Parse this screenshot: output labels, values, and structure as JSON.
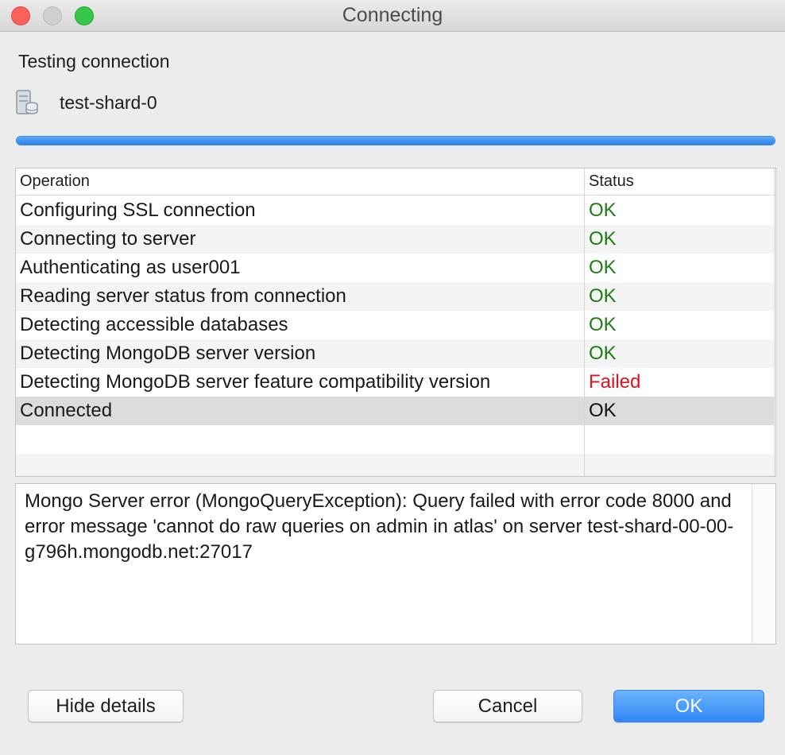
{
  "window": {
    "title": "Connecting"
  },
  "header": {
    "status_text": "Testing connection",
    "server_name": "test-shard-0"
  },
  "progress": {
    "value": 100
  },
  "table": {
    "columns": {
      "operation": "Operation",
      "status": "Status"
    },
    "rows": [
      {
        "operation": "Configuring SSL connection",
        "status": "OK"
      },
      {
        "operation": "Connecting to server",
        "status": "OK"
      },
      {
        "operation": "Authenticating as user001",
        "status": "OK"
      },
      {
        "operation": "Reading server status from connection",
        "status": "OK"
      },
      {
        "operation": "Detecting accessible databases",
        "status": "OK"
      },
      {
        "operation": "Detecting MongoDB server version",
        "status": "OK"
      },
      {
        "operation": "Detecting MongoDB server feature compatibility version",
        "status": "Failed"
      },
      {
        "operation": "Connected",
        "status": "OK"
      }
    ]
  },
  "details": {
    "message": "Mongo Server error (MongoQueryException): Query failed with error code 8000 and error message 'cannot do raw queries on admin in atlas' on server test-shard-00-00-g796h.mongodb.net:27017"
  },
  "buttons": {
    "hide_details": "Hide details",
    "cancel": "Cancel",
    "ok": "OK"
  },
  "colors": {
    "ok_status": "#1d7d14",
    "failed_status": "#e0121e",
    "accent": "#2f86f6"
  },
  "icons": {
    "server": "database-server-icon"
  }
}
